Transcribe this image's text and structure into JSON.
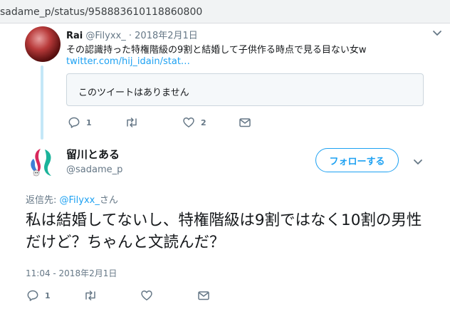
{
  "browser": {
    "url": "sadame_p/status/958883610118860800"
  },
  "quoted_tweet": {
    "name": "Rai",
    "handle": "@Filyxx_",
    "separator": "·",
    "time": "2018年2月1日",
    "text": "その認識持った特権階級の9割と結婚して子供作る時点で見る目ない女w",
    "link": "twitter.com/hij_idain/stat…",
    "unavailable_quote": "このツイートはありません",
    "reply_count": "1",
    "retweet_count": "",
    "like_count": "2"
  },
  "main_tweet": {
    "name": "留川とある",
    "handle": "@sadame_p",
    "follow_label": "フォローする",
    "reply_prefix": "返信先: ",
    "reply_mention": "@Filyxx_",
    "reply_suffix": "さん",
    "text": "私は結婚してないし、特権階級は9割ではなく10割の男性だけど？ちゃんと文読んだ？",
    "timestamp": "11:04 - 2018年2月1日",
    "reply_count": "1",
    "retweet_count": "",
    "like_count": ""
  },
  "colors": {
    "accent": "#1da1f2",
    "muted": "#657786",
    "thread_line": "#c4e7f7"
  }
}
